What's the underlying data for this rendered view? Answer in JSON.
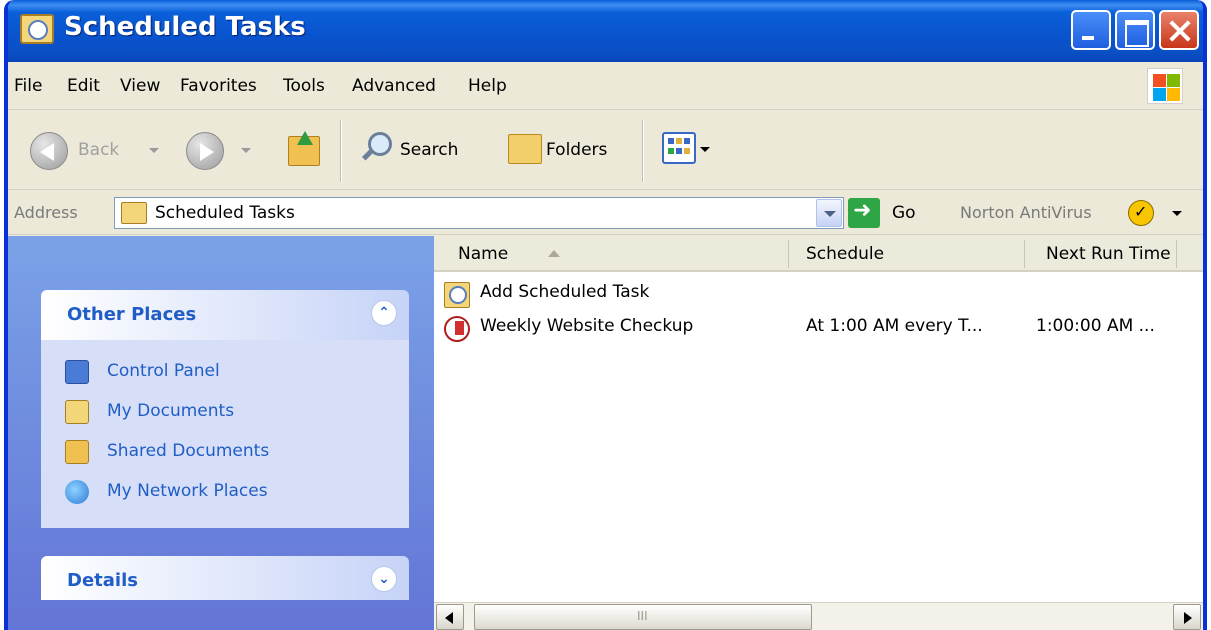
{
  "window": {
    "title": "Scheduled Tasks"
  },
  "menu": [
    "File",
    "Edit",
    "View",
    "Favorites",
    "Tools",
    "Advanced",
    "Help"
  ],
  "toolbar": {
    "back_label": "Back",
    "search_label": "Search",
    "folders_label": "Folders"
  },
  "address": {
    "label": "Address",
    "value": "Scheduled Tasks",
    "go_label": "Go",
    "norton_label": "Norton AntiVirus"
  },
  "taskpane": {
    "other_places": {
      "title": "Other Places",
      "items": [
        "Control Panel",
        "My Documents",
        "Shared Documents",
        "My Network Places"
      ]
    },
    "details": {
      "title": "Details"
    }
  },
  "listview": {
    "columns": [
      "Name",
      "Schedule",
      "Next Run Time"
    ],
    "rows": [
      {
        "name": "Add Scheduled Task",
        "schedule": "",
        "next": ""
      },
      {
        "name": "Weekly Website Checkup",
        "schedule": "At 1:00 AM every T...",
        "next": "1:00:00 AM ..."
      }
    ],
    "scroll_grip": "III"
  },
  "colors": {
    "titlebar": "#0a5fd8",
    "taskpane": "#6f8ce0",
    "link": "#215dc6"
  },
  "icons": {
    "title": "scheduled-tasks-folder-icon",
    "back": "back-arrow-icon",
    "forward": "forward-arrow-icon",
    "up": "up-folder-icon",
    "search": "search-icon",
    "folders": "folders-icon",
    "views": "views-icon",
    "go": "go-arrow-icon",
    "norton": "norton-antivirus-icon"
  }
}
